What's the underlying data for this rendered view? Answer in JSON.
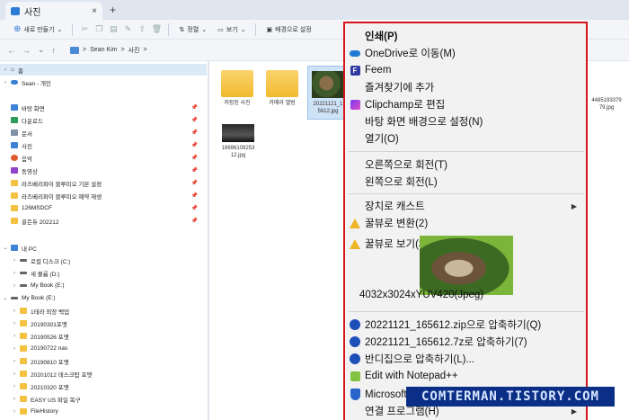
{
  "tab": {
    "title": "사진",
    "close": "×",
    "new": "+"
  },
  "cmdbar": {
    "new_label": "새로 만들기",
    "sort_label": "정렬",
    "view_label": "보기",
    "set_bg_label": "배경으로 설정"
  },
  "address": {
    "user": "Sean Kim",
    "folder": "사진",
    "sep": ">"
  },
  "sidebar": {
    "items": [
      {
        "label": "홈",
        "icon": "home-icon"
      },
      {
        "label": "Sean - 개인",
        "icon": "onedrive-icon"
      },
      {
        "label": "바탕 화면",
        "icon": "desktop-icon"
      },
      {
        "label": "다운로드",
        "icon": "download-icon"
      },
      {
        "label": "문서",
        "icon": "document-icon"
      },
      {
        "label": "사진",
        "icon": "pictures-icon"
      },
      {
        "label": "음악",
        "icon": "music-icon"
      },
      {
        "label": "동영상",
        "icon": "video-icon"
      },
      {
        "label": "라즈베리파이 블루미오 기본 설정",
        "icon": "folder-icon"
      },
      {
        "label": "라즈베리파이 블루미오 예약 재생",
        "icon": "folder-icon"
      },
      {
        "label": "126MSDCF",
        "icon": "folder-icon"
      },
      {
        "label": "골든듀 202212",
        "icon": "folder-icon"
      },
      {
        "label": "내 PC",
        "icon": "pc-icon"
      },
      {
        "label": "로컬 디스크 (C:)",
        "icon": "drive-icon"
      },
      {
        "label": "새 볼륨 (D:)",
        "icon": "drive-icon"
      },
      {
        "label": "My Book (E:)",
        "icon": "drive-icon"
      },
      {
        "label": "My Book (E:)",
        "icon": "drive-icon"
      },
      {
        "label": "1테라 외장 백업",
        "icon": "folder-icon"
      },
      {
        "label": "20190301포맷",
        "icon": "folder-icon"
      },
      {
        "label": "20190526 포맷",
        "icon": "folder-icon"
      },
      {
        "label": "20190722 nas",
        "icon": "folder-icon"
      },
      {
        "label": "20190810 포맷",
        "icon": "folder-icon"
      },
      {
        "label": "20201012 데스크탑 포맷",
        "icon": "folder-icon"
      },
      {
        "label": "20210320 포맷",
        "icon": "folder-icon"
      },
      {
        "label": "EASY US 파일 복구",
        "icon": "folder-icon"
      },
      {
        "label": "FileHistory",
        "icon": "folder-icon"
      }
    ],
    "pin": "📌"
  },
  "files": [
    {
      "name": "저장된 사진",
      "kind": "folder"
    },
    {
      "name": "카메라 앨범",
      "kind": "folder"
    },
    {
      "name": "20221121_1 5612.jpg",
      "kind": "cat"
    },
    {
      "name": "16696108253 12.jpg",
      "kind": "car"
    },
    {
      "name": "4485193379 79.jpg",
      "kind": "partial"
    }
  ],
  "menu": {
    "items": [
      {
        "label": "인쇄(P)",
        "bold": true
      },
      {
        "label": "OneDrive로 이동(M)",
        "icon": "onedrive-icon"
      },
      {
        "label": "Feem",
        "icon": "feem-icon"
      },
      {
        "label": "즐겨찾기에 추가"
      },
      {
        "label": "Clipchamp로 편집",
        "icon": "clipchamp-icon"
      },
      {
        "label": "바탕 화면 배경으로 설정(N)"
      },
      {
        "label": "열기(O)"
      },
      {
        "label": "오른쪽으로 회전(T)"
      },
      {
        "label": "왼쪽으로 회전(L)"
      },
      {
        "label": "장치로 캐스트",
        "submenu": true
      },
      {
        "label": "꿀뷰로 변환(2)",
        "icon": "honeyview-icon"
      },
      {
        "label": "꿀뷰로 보기(3)",
        "icon": "honeyview-icon"
      },
      {
        "label": "20221121_165612.zip으로 압축하기(Q)",
        "icon": "bandizip-icon"
      },
      {
        "label": "20221121_165612.7z로 압축하기(7)",
        "icon": "bandizip-icon"
      },
      {
        "label": "반디집으로 압축하기(L)...",
        "icon": "bandizip-icon"
      },
      {
        "label": "Edit with Notepad++",
        "icon": "notepadpp-icon"
      },
      {
        "label": "Microsoft Defender(으)로 검사",
        "icon": "defender-icon"
      },
      {
        "label": "연결 프로그램(H)",
        "submenu": true
      }
    ],
    "preview_caption": "4032x3024xYUV420(Jpeg)",
    "submenu_arrow": "▶"
  },
  "watermark": "COMTERMAN.TISTORY.COM"
}
